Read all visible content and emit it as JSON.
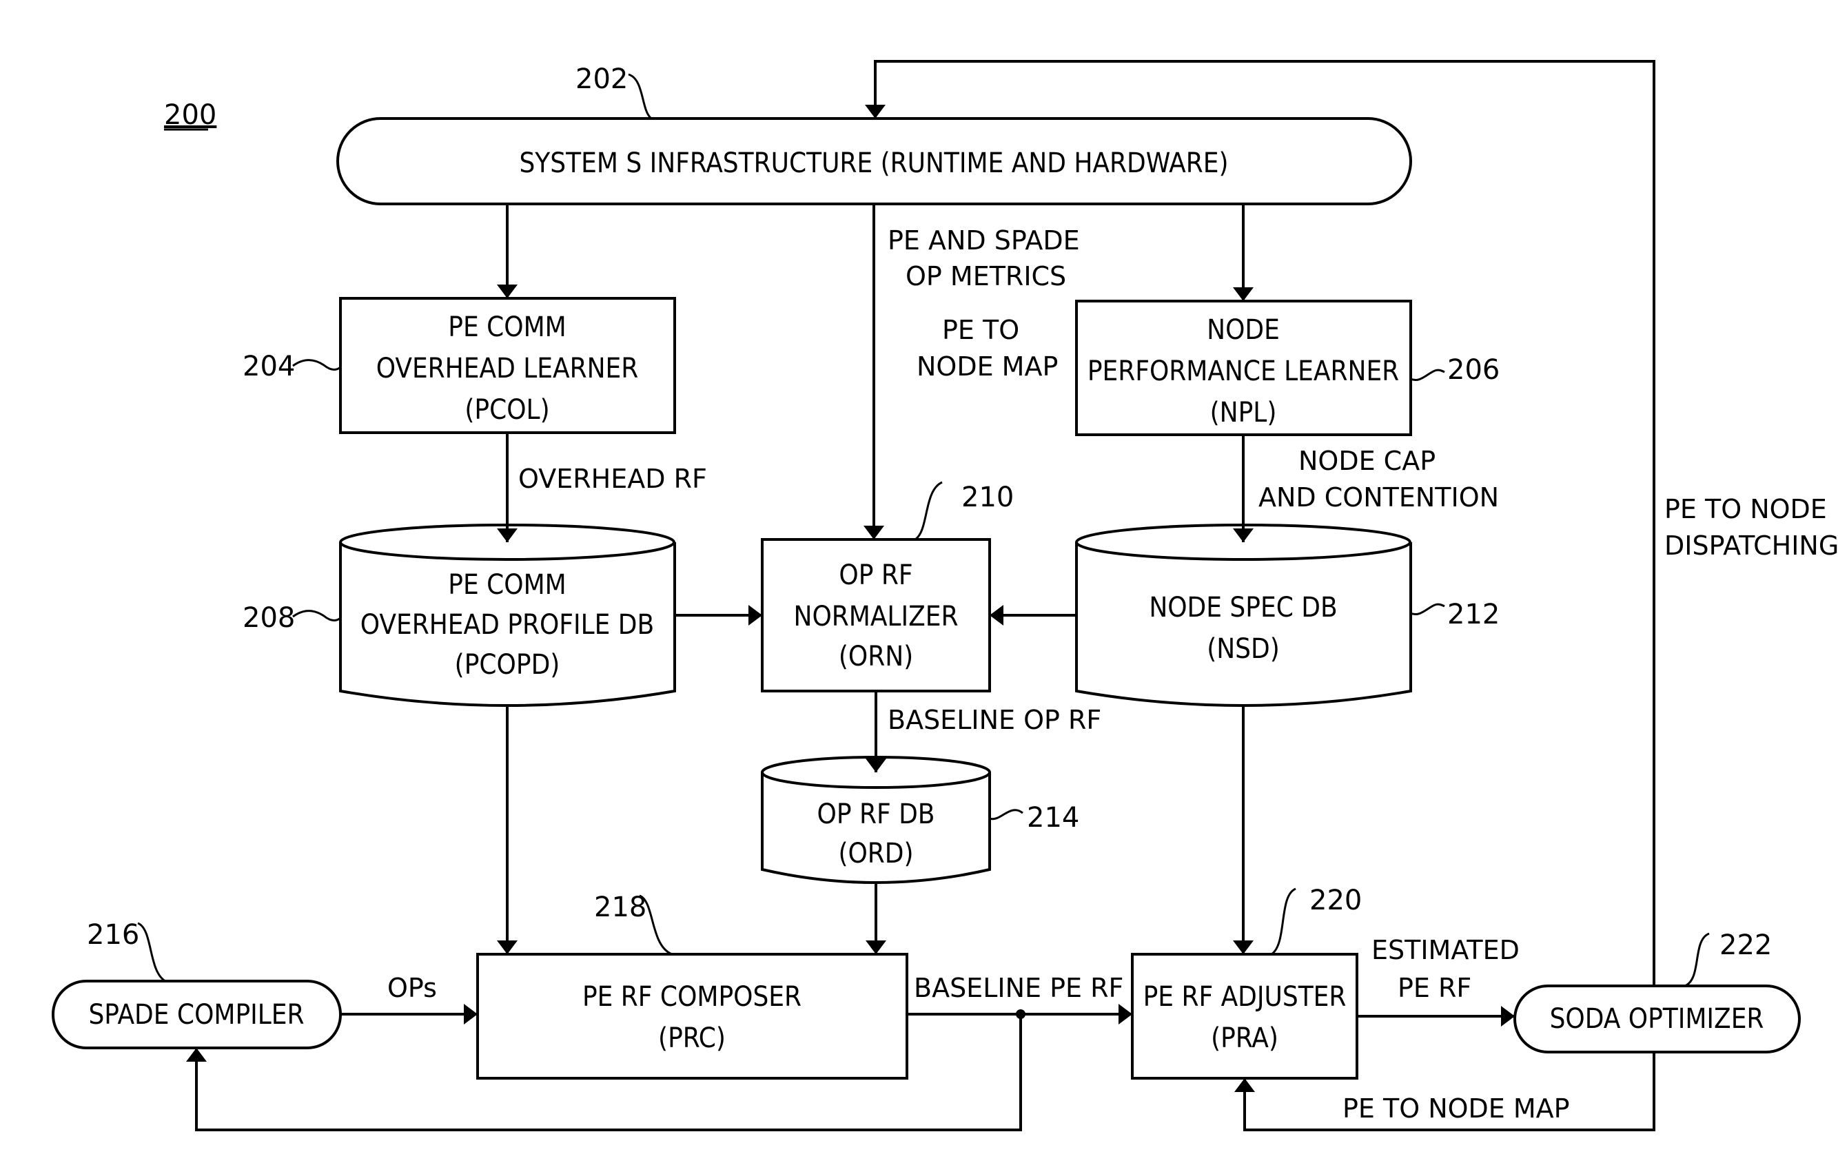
{
  "figure": {
    "number": "200"
  },
  "nodes": {
    "infrastructure": {
      "ref": "202",
      "lines": [
        "SYSTEM S INFRASTRUCTURE (RUNTIME AND HARDWARE)"
      ]
    },
    "pcol": {
      "ref": "204",
      "lines": [
        "PE COMM",
        "OVERHEAD LEARNER",
        "(PCOL)"
      ]
    },
    "npl": {
      "ref": "206",
      "lines": [
        "NODE",
        "PERFORMANCE LEARNER",
        "(NPL)"
      ]
    },
    "pcopd": {
      "ref": "208",
      "lines": [
        "PE COMM",
        "OVERHEAD PROFILE DB",
        "(PCOPD)"
      ]
    },
    "orn": {
      "ref": "210",
      "lines": [
        "OP RF",
        "NORMALIZER",
        "(ORN)"
      ]
    },
    "nsd": {
      "ref": "212",
      "lines": [
        "NODE SPEC DB",
        "(NSD)"
      ]
    },
    "ord": {
      "ref": "214",
      "lines": [
        "OP RF DB",
        "(ORD)"
      ]
    },
    "spade_compiler": {
      "ref": "216",
      "lines": [
        "SPADE COMPILER"
      ]
    },
    "prc": {
      "ref": "218",
      "lines": [
        "PE RF COMPOSER",
        "(PRC)"
      ]
    },
    "pra": {
      "ref": "220",
      "lines": [
        "PE RF ADJUSTER",
        "(PRA)"
      ]
    },
    "soda": {
      "ref": "222",
      "lines": [
        "SODA OPTIMIZER"
      ]
    }
  },
  "edges": {
    "overhead_rf": "OVERHEAD RF",
    "pe_spade_metrics": [
      "PE AND SPADE",
      "OP METRICS"
    ],
    "pe_to_node_map_top": [
      "PE TO",
      "NODE MAP"
    ],
    "node_cap": [
      "NODE CAP",
      "AND CONTENTION"
    ],
    "baseline_op_rf": "BASELINE OP RF",
    "ops": "OPs",
    "baseline_pe_rf": "BASELINE PE RF",
    "estimated_pe_rf": [
      "ESTIMATED",
      "PE RF"
    ],
    "pe_to_node_map_bottom": "PE TO NODE MAP",
    "pe_to_node_dispatching": [
      "PE TO NODE",
      "DISPATCHING"
    ]
  }
}
